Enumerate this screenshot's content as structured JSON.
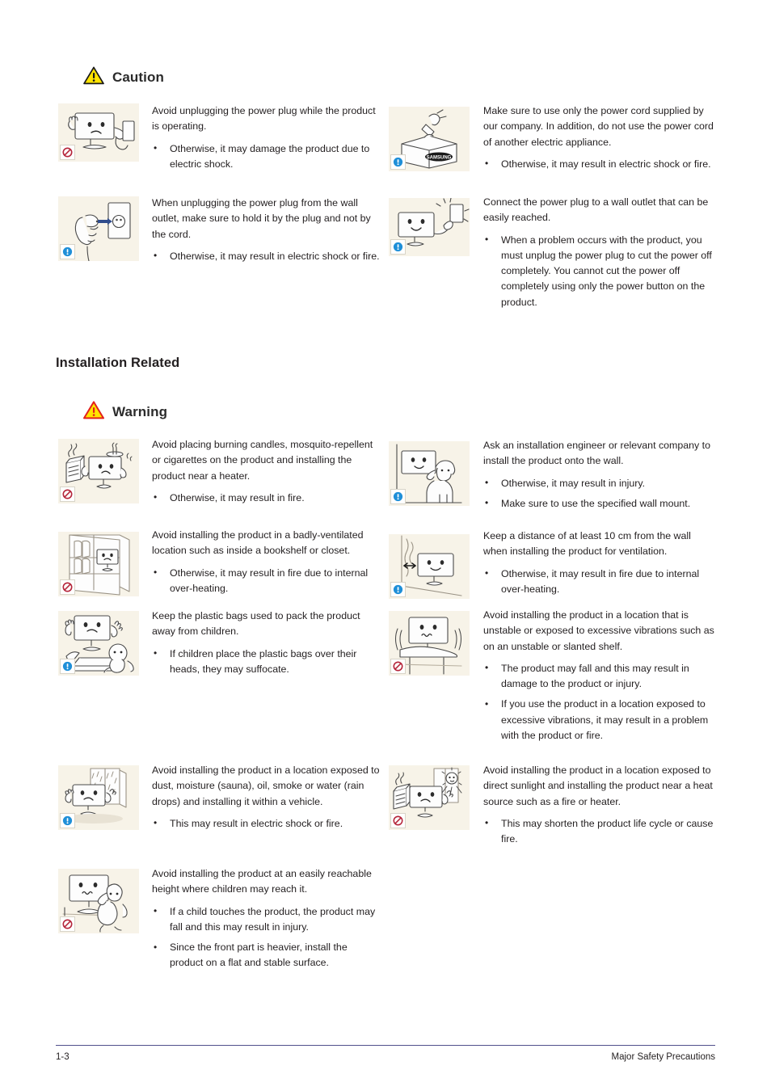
{
  "page": {
    "footer_page_number": "1-3",
    "footer_chapter": "Major Safety Precautions"
  },
  "sections": [
    {
      "id": "caution",
      "heading_type": "alert",
      "heading_label": "Caution",
      "icon": "warning-triangle-yellow-icon"
    },
    {
      "id": "installation-related",
      "heading_type": "section",
      "heading_label": "Installation Related"
    },
    {
      "id": "warning",
      "heading_type": "alert",
      "heading_label": "Warning",
      "icon": "warning-triangle-red-icon"
    }
  ],
  "entries": {
    "c1": {
      "badge": "prohibition-icon",
      "illustration": "monitor-unplugging-power-plug",
      "text": "Avoid unplugging the power plug while the product is operating.",
      "bullets": [
        "Otherwise, it may damage the product due to electric shock."
      ]
    },
    "c2": {
      "badge": "mandatory-info-icon",
      "illustration": "hand-holding-plug-at-wall-outlet",
      "text": "When unplugging the power plug from the wall outlet, make sure to hold it by the plug and not by the cord.",
      "bullets": [
        "Otherwise, it may result in electric shock or fire."
      ]
    },
    "c3": {
      "badge": "mandatory-info-icon",
      "illustration": "power-cord-in-samsung-box",
      "text": "Make sure to use only the power cord supplied by our company. In addition, do not use the power cord of another electric appliance.",
      "bullets": [
        "Otherwise, it may result in electric shock or fire."
      ]
    },
    "c4": {
      "badge": "mandatory-info-icon",
      "illustration": "monitor-plug-into-accessible-outlet",
      "text": "Connect the power plug to a wall outlet that can be easily reached.",
      "bullets": [
        "When a problem occurs with the product, you must unplug the power plug to cut the power off completely. You cannot cut the power off completely using only the power button on the product."
      ]
    },
    "w1": {
      "badge": "prohibition-icon",
      "illustration": "monitor-near-heater-and-candle",
      "text": "Avoid placing burning candles,  mosquito-repellent or cigarettes on the product and installing the product near a heater.",
      "bullets": [
        "Otherwise, it may result in fire."
      ]
    },
    "w2": {
      "badge": "mandatory-info-icon",
      "illustration": "installer-mounting-monitor-on-wall",
      "text": "Ask an installation engineer or relevant company to install the product onto the wall.",
      "bullets": [
        "Otherwise, it may result in injury.",
        "Make sure to use the specified wall mount."
      ]
    },
    "w3": {
      "badge": "prohibition-icon",
      "illustration": "monitor-inside-bookshelf",
      "text": "Avoid installing the product in a badly-ventilated location such as inside a bookshelf or closet.",
      "bullets": [
        "Otherwise, it may result in fire due to internal over-heating."
      ]
    },
    "w4": {
      "badge": "mandatory-info-icon",
      "illustration": "monitor-10cm-from-wall",
      "text": "Keep a distance of at least 10 cm from the wall when installing the product for ventilation.",
      "bullets": [
        "Otherwise, it may result in fire due to internal over-heating."
      ]
    },
    "w5": {
      "badge": "mandatory-info-icon",
      "illustration": "child-with-plastic-bags-and-monitor",
      "text": "Keep the plastic bags used to pack the product away from children.",
      "bullets": [
        " If children place the plastic bags over their heads, they may suffocate."
      ]
    },
    "w6": {
      "badge": "prohibition-icon",
      "illustration": "monitor-on-unstable-shaking-table",
      "text": "Avoid installing the product in a location that is unstable or exposed to excessive vibrations such as on an unstable or slanted shelf.",
      "bullets": [
        "The product may fall and this may result in damage to the product or injury.",
        "If you use the product in a location exposed to excessive vibrations, it may result in a problem with the product or fire."
      ]
    },
    "w7": {
      "badge": "mandatory-info-icon",
      "illustration": "monitor-near-rainy-window",
      "text": "Avoid installing the product in a location exposed to dust, moisture (sauna), oil, smoke or water (rain drops) and installing it within a vehicle.",
      "bullets": [
        "This may result in electric shock or fire."
      ]
    },
    "w8": {
      "badge": "prohibition-icon",
      "illustration": "monitor-in-sunlight-near-heater",
      "text": "Avoid installing the product in a location exposed to direct sunlight and installing the product near a heat source such as a fire or heater.",
      "bullets": [
        "This may shorten the product life cycle or cause fire."
      ]
    },
    "w9": {
      "badge": "prohibition-icon",
      "illustration": "child-reaching-monitor-on-table",
      "text": "Avoid installing the product at an easily reachable height where children may reach it.",
      "bullets": [
        "If a child touches the product, the product may fall and this may result in injury.",
        "Since the front part is heavier, install the product on a flat and stable surface."
      ]
    }
  },
  "colors": {
    "illustration_background": "#f7f3e8",
    "caution_triangle": "#ffe400",
    "warning_triangle_border": "#e2211c",
    "prohibition": "#b5253a",
    "info_badge": "#1f8fd8",
    "footer_rule": "#51508c",
    "text": "#231f20"
  }
}
